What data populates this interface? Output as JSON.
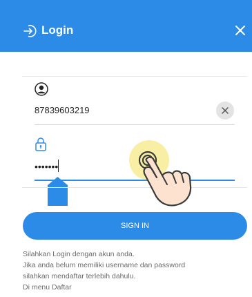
{
  "header": {
    "title": "Login",
    "login_icon": "login-arrow-icon",
    "close_icon": "close-icon",
    "background": "#2d8be8"
  },
  "form": {
    "user_icon": "user-icon",
    "username_value": "87839603219",
    "clear_icon": "clear-icon",
    "lock_icon": "lock-icon",
    "password_value": "•••••••",
    "accent": "#2d8be8"
  },
  "signin_button": {
    "label": "SIGN IN"
  },
  "info_lines": [
    "Silahkan Login dengan akun anda.",
    "Jika anda belum memiliki username dan password",
    "silahkan mendaftar terlebih dahulu.",
    "Di menu Daftar"
  ],
  "overlay": {
    "tap_indicator_icon": "tap-hand-icon",
    "cursor_handle_icon": "text-cursor-handle-icon"
  }
}
